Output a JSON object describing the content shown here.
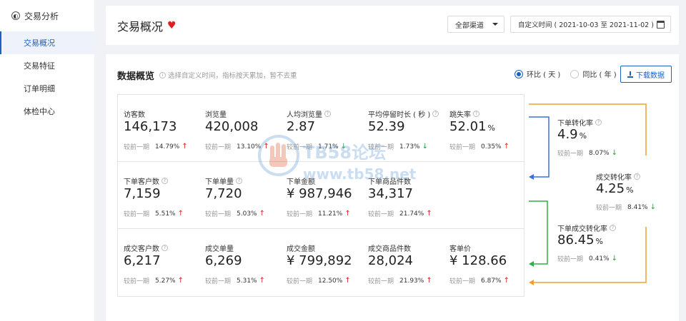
{
  "sidebar": {
    "header": "交易分析",
    "items": [
      {
        "label": "交易概况",
        "active": true
      },
      {
        "label": "交易特征",
        "active": false
      },
      {
        "label": "订单明细",
        "active": false
      },
      {
        "label": "体检中心",
        "active": false
      }
    ]
  },
  "header": {
    "title": "交易概况",
    "channel_select": "全部渠道",
    "date_range": "自定义时间 ( 2021-10-03 至 2021-11-02 )"
  },
  "overview": {
    "title": "数据概览",
    "hint": "选择自定义时间，指标按天累加，暂不去重",
    "radio_hb": "环比 ( 天 )",
    "radio_tb": "同比 ( 年 )",
    "download": "下载数据"
  },
  "compare_label": "较前一期",
  "metrics": [
    {
      "label": "访客数",
      "value": "146,173",
      "unit": "",
      "pct": "14.79%",
      "trend": "up",
      "help": false
    },
    {
      "label": "浏览量",
      "value": "420,008",
      "unit": "",
      "pct": "13.10%",
      "trend": "up",
      "help": false
    },
    {
      "label": "人均浏览量",
      "value": "2.87",
      "unit": "",
      "pct": "1.71%",
      "trend": "down",
      "help": true
    },
    {
      "label": "平均停留时长 ( 秒 )",
      "value": "52.39",
      "unit": "",
      "pct": "1.73%",
      "trend": "down",
      "help": true
    },
    {
      "label": "跳失率",
      "value": "52.01",
      "unit": "%",
      "pct": "0.35%",
      "trend": "up",
      "help": true
    },
    {
      "label": "下单客户数",
      "value": "7,159",
      "unit": "",
      "pct": "5.51%",
      "trend": "up",
      "help": true
    },
    {
      "label": "下单单量",
      "value": "7,720",
      "unit": "",
      "pct": "5.03%",
      "trend": "up",
      "help": true
    },
    {
      "label": "下单金额",
      "value": "¥ 987,946",
      "unit": "",
      "pct": "11.21%",
      "trend": "up",
      "help": false
    },
    {
      "label": "下单商品件数",
      "value": "34,317",
      "unit": "",
      "pct": "21.74%",
      "trend": "up",
      "help": false
    },
    {
      "label": "成交客户数",
      "value": "6,217",
      "unit": "",
      "pct": "5.27%",
      "trend": "up",
      "help": true
    },
    {
      "label": "成交单量",
      "value": "6,269",
      "unit": "",
      "pct": "5.31%",
      "trend": "up",
      "help": false
    },
    {
      "label": "成交金额",
      "value": "¥ 799,892",
      "unit": "",
      "pct": "12.50%",
      "trend": "up",
      "help": false
    },
    {
      "label": "成交商品件数",
      "value": "28,024",
      "unit": "",
      "pct": "21.93%",
      "trend": "up",
      "help": false
    },
    {
      "label": "客单价",
      "value": "¥ 128.66",
      "unit": "",
      "pct": "6.87%",
      "trend": "up",
      "help": false
    }
  ],
  "conversions": [
    {
      "label": "下单转化率",
      "value": "4.9",
      "unit": "%",
      "pct": "8.07%",
      "trend": "down"
    },
    {
      "label": "成交转化率",
      "value": "4.25",
      "unit": "%",
      "pct": "8.41%",
      "trend": "down"
    },
    {
      "label": "下单成交转化率",
      "value": "86.45",
      "unit": "%",
      "pct": "0.41%",
      "trend": "down"
    }
  ],
  "watermark": {
    "line1": "TB58论坛",
    "line2": "www.tb58.net"
  },
  "colors": {
    "accent": "#1f5fbf",
    "up": "#e02020",
    "down": "#20a040",
    "flow_orange": "#f0a030",
    "flow_blue": "#3a70d8",
    "flow_green": "#30b040"
  },
  "icons": {
    "arrow_up": "↑",
    "arrow_down": "↓",
    "heart": "♥",
    "help": "?"
  }
}
